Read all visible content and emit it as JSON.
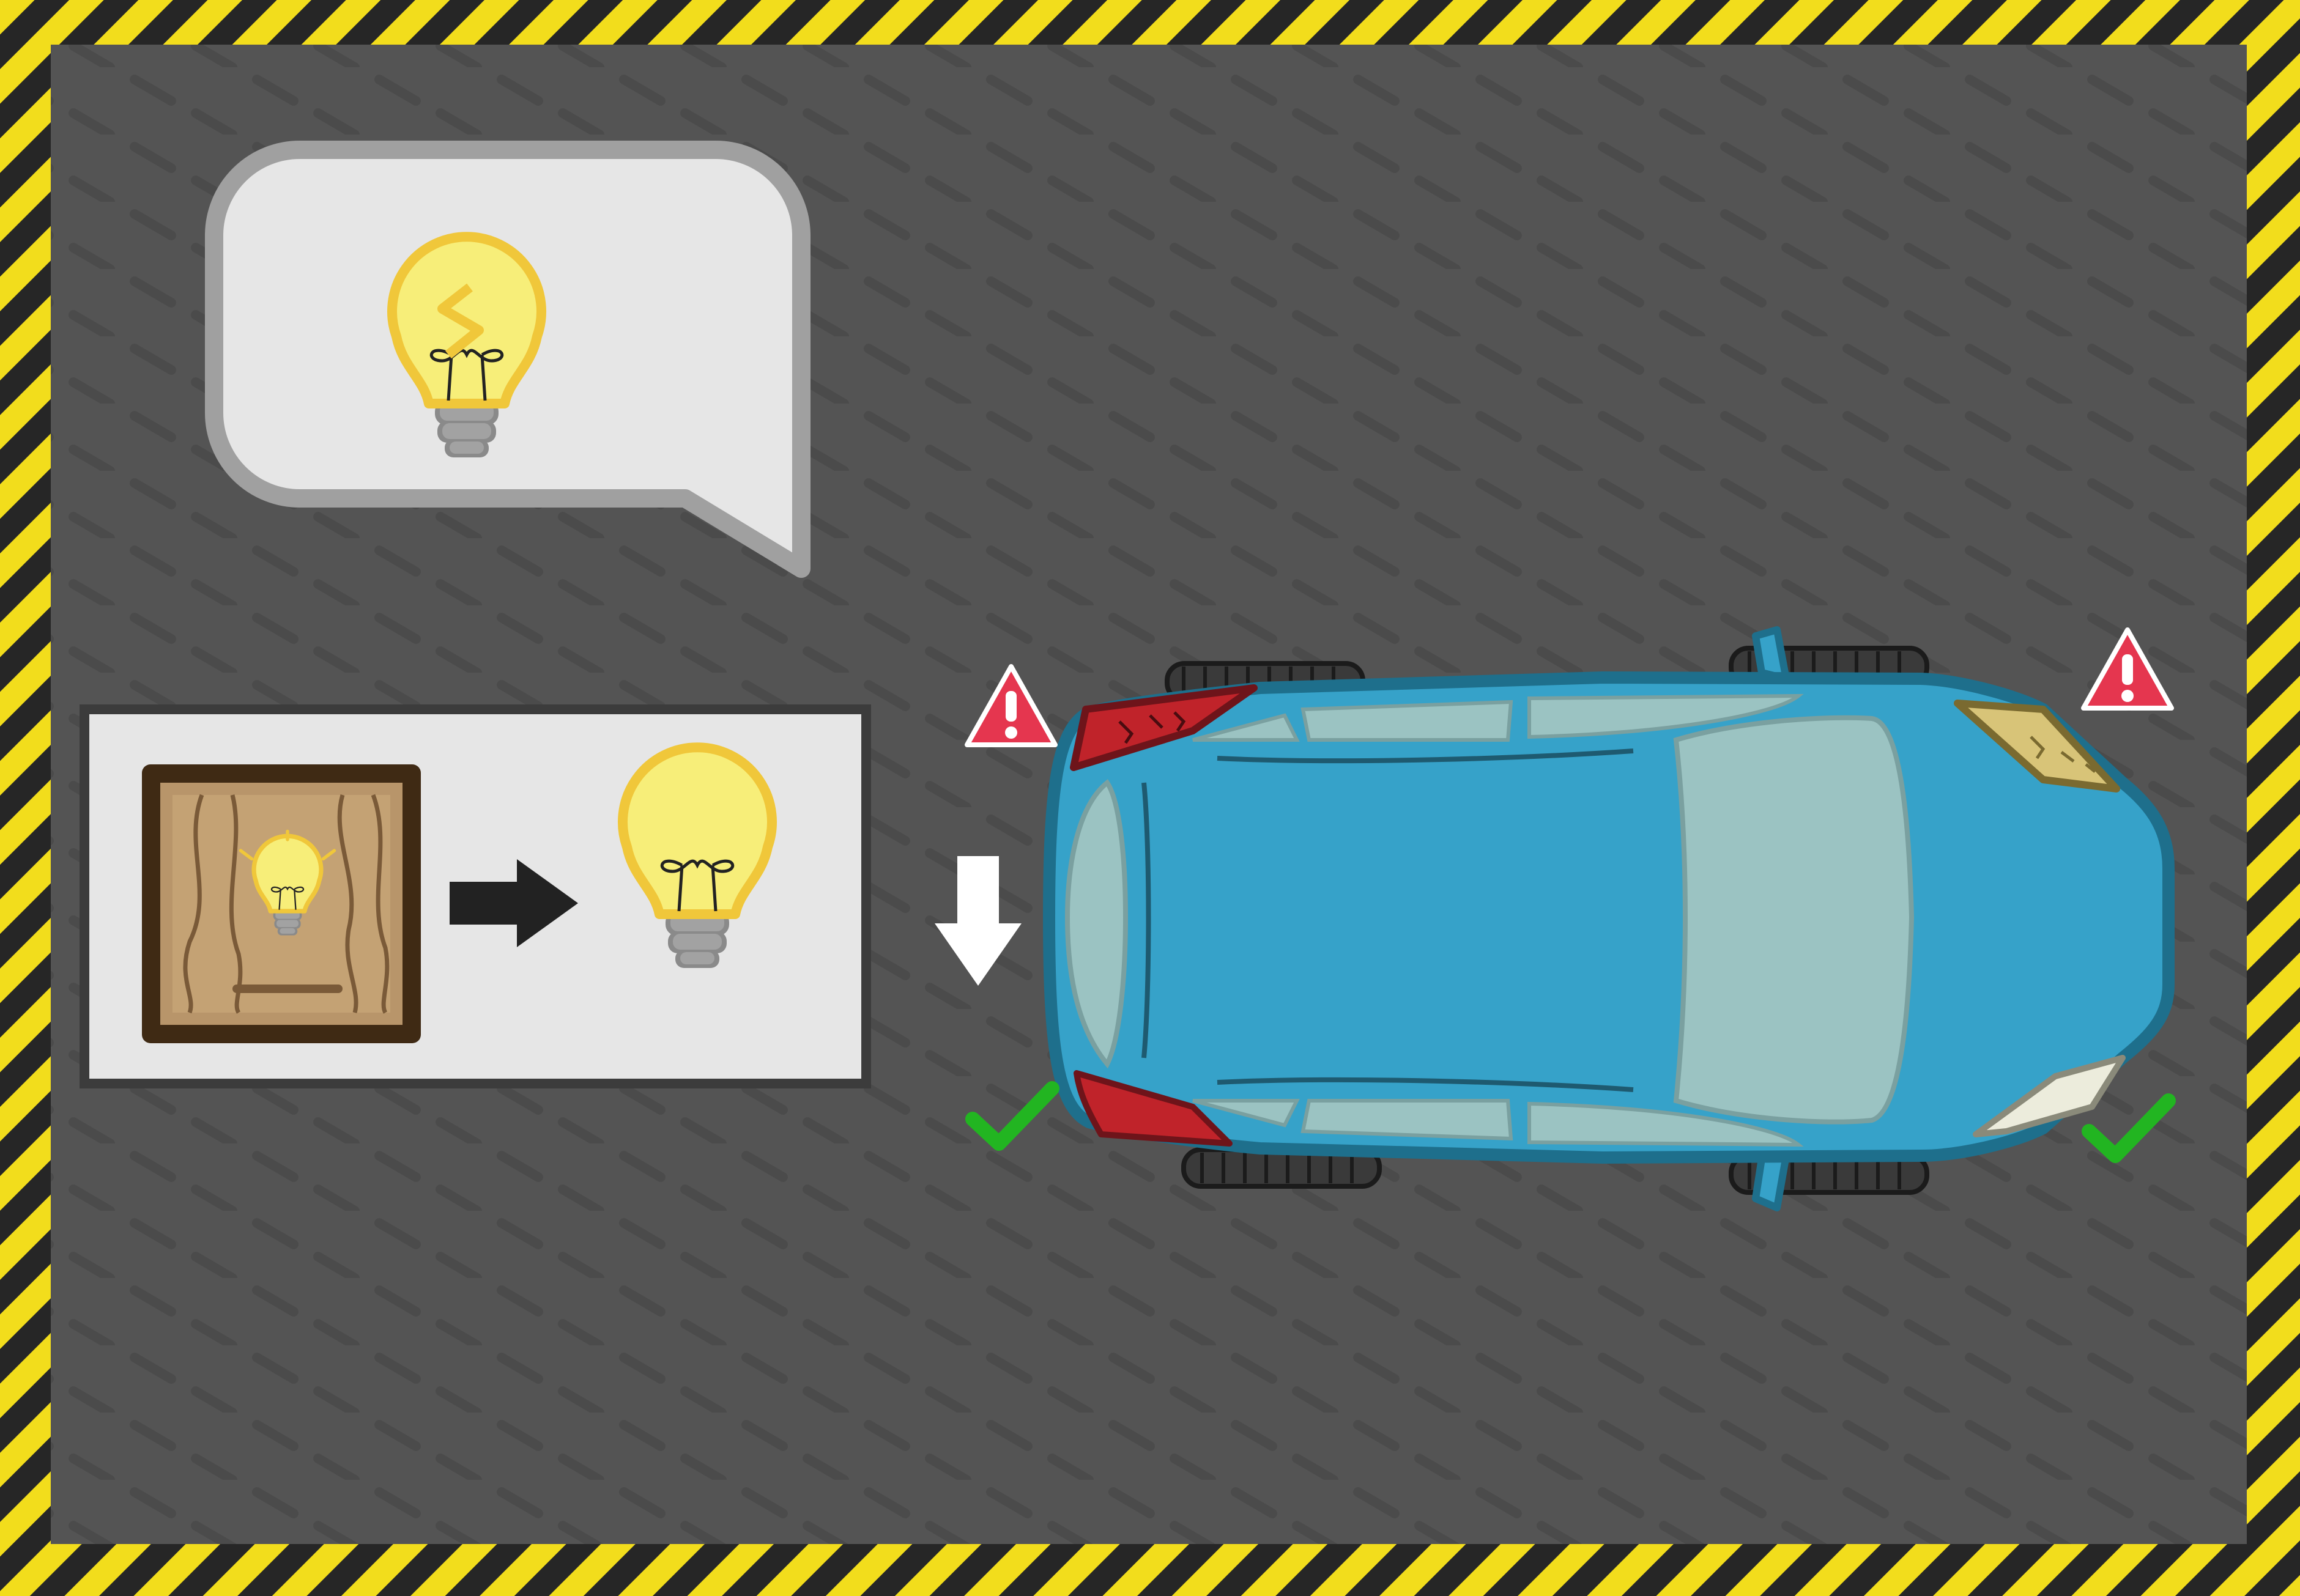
{
  "scene": {
    "border_colors": {
      "stripe_yellow": "#f2dd1c",
      "stripe_black": "#262626"
    },
    "floor_color": "#545454",
    "floor_mark_color": "#4a4a4a"
  },
  "hint_bubble": {
    "icon": "broken-lightbulb-icon",
    "bubble_color": "#e6e6e6",
    "bubble_border": "#a0a0a0"
  },
  "recipe_panel": {
    "input_icon": "lightbulb-crate-icon",
    "arrow_icon": "right-arrow-icon",
    "output_icon": "lightbulb-icon"
  },
  "drop_indicator": {
    "icon": "down-arrow-icon",
    "color": "#ffffff"
  },
  "car": {
    "body_color": "#36a2c9",
    "outline_color": "#1e6f8c",
    "glass_color": "#9bc3c2",
    "lights": [
      {
        "id": "rear-left",
        "status": "broken",
        "marker": "warning-icon"
      },
      {
        "id": "rear-right",
        "status": "ok",
        "marker": "checkmark-icon"
      },
      {
        "id": "front-left",
        "status": "broken",
        "marker": "warning-icon"
      },
      {
        "id": "front-right",
        "status": "ok",
        "marker": "checkmark-icon"
      }
    ]
  },
  "status_colors": {
    "warning": "#e5364f",
    "ok": "#22b521"
  }
}
